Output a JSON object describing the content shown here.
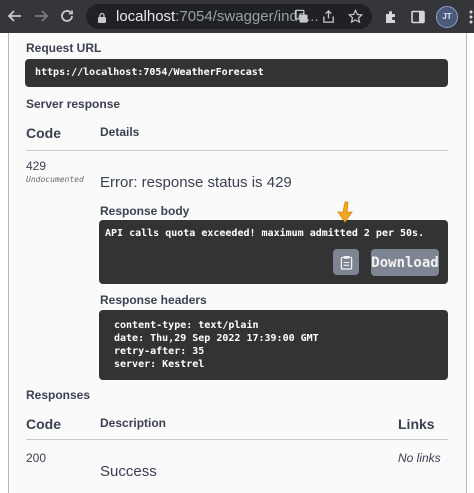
{
  "browser": {
    "url_host": "localhost",
    "url_rest": ":7054/swagger/inde..."
  },
  "profile": {
    "initials": "JT"
  },
  "request_url": {
    "label": "Request URL",
    "value": "https://localhost:7054/WeatherForecast"
  },
  "server_response": {
    "label": "Server response",
    "code_header": "Code",
    "details_header": "Details",
    "code": "429",
    "code_note": "Undocumented",
    "error_text": "Error: response status is 429",
    "body_label": "Response body",
    "body": "API calls quota exceeded! maximum admitted 2 per 50s.",
    "download_label": "Download",
    "headers_label": "Response headers",
    "headers": [
      "content-type: text/plain",
      "date: Thu,29 Sep 2022 17:39:00 GMT",
      "retry-after: 35",
      "server: Kestrel"
    ]
  },
  "responses": {
    "label": "Responses",
    "code_header": "Code",
    "description_header": "Description",
    "links_header": "Links",
    "rows": [
      {
        "code": "200",
        "description": "Success",
        "links": "No links"
      }
    ]
  },
  "colors": {
    "code_bg": "#333333",
    "cursor": "#f5a623",
    "chrome_bg": "#35363a"
  }
}
